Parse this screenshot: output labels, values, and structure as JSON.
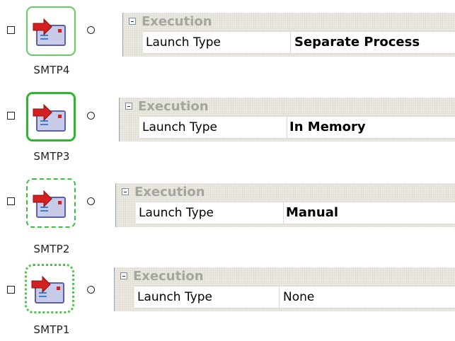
{
  "tasks": [
    {
      "name": "SMTP4",
      "category": "Execution",
      "property": "Launch Type",
      "value": "Separate Process",
      "value_bold": true,
      "border_style": "solid-thin"
    },
    {
      "name": "SMTP3",
      "category": "Execution",
      "property": "Launch Type",
      "value": "In Memory",
      "value_bold": true,
      "border_style": "solid-thick"
    },
    {
      "name": "SMTP2",
      "category": "Execution",
      "property": "Launch Type",
      "value": "Manual",
      "value_bold": true,
      "border_style": "dashed"
    },
    {
      "name": "SMTP1",
      "category": "Execution",
      "property": "Launch Type",
      "value": "None",
      "value_bold": false,
      "border_style": "dotted"
    }
  ],
  "colors": {
    "task_border_green": "#3cbf3c",
    "category_text": "#a5a5a0",
    "grid_background": "#eceae3",
    "envelope_body": "#c8cbe8",
    "arrow_red": "#d42020"
  },
  "icons": {
    "task_icon": "envelope-with-arrow-icon",
    "category_toggle": "collapse-minus-icon"
  }
}
